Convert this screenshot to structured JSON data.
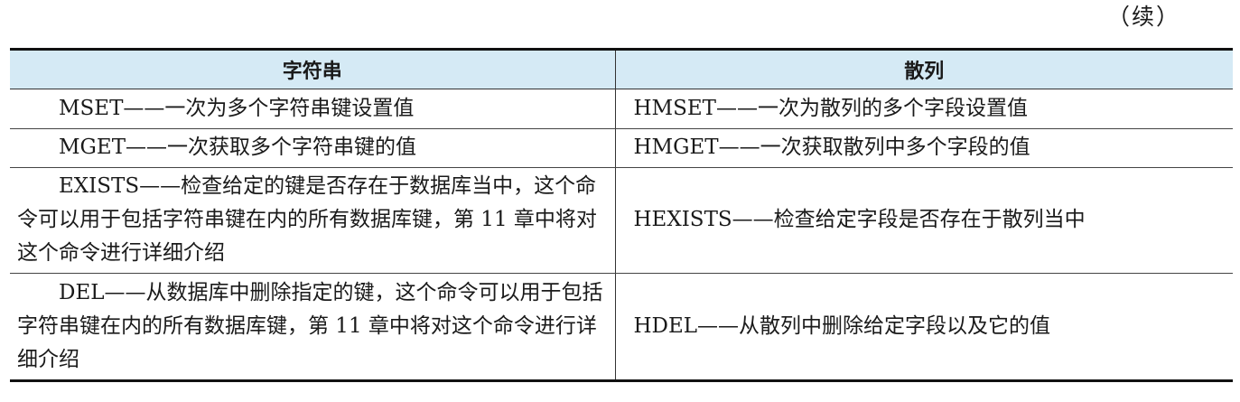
{
  "continued_mark": "（续）",
  "table": {
    "headers": {
      "string": "字符串",
      "hash": "散列"
    },
    "rows": [
      {
        "string": "MSET——一次为多个字符串键设置值",
        "hash": "HMSET——一次为散列的多个字段设置值"
      },
      {
        "string": "MGET——一次获取多个字符串键的值",
        "hash": "HMGET——一次获取散列中多个字段的值"
      },
      {
        "string": "EXISTS——检查给定的键是否存在于数据库当中，这个命令可以用于包括字符串键在内的所有数据库键，第 11 章中将对这个命令进行详细介绍",
        "hash": "HEXISTS——检查给定字段是否存在于散列当中"
      },
      {
        "string": "DEL——从数据库中删除指定的键，这个命令可以用于包括字符串键在内的所有数据库键，第 11 章中将对这个命令进行详细介绍",
        "hash": "HDEL——从散列中删除给定字段以及它的值"
      }
    ]
  }
}
